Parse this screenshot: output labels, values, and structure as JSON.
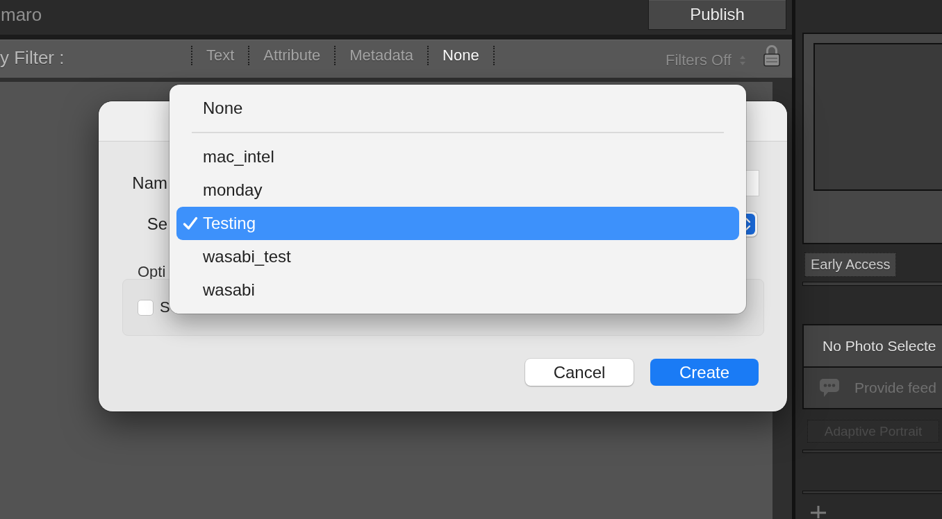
{
  "app_bar": {
    "title": "maro",
    "publish_button": "Publish"
  },
  "filter_bar": {
    "label": "y Filter :",
    "tabs": [
      {
        "label": "Text",
        "selected": false
      },
      {
        "label": "Attribute",
        "selected": false
      },
      {
        "label": "Metadata",
        "selected": false
      },
      {
        "label": "None",
        "selected": true
      }
    ],
    "filters_dropdown": "Filters Off"
  },
  "right_panel": {
    "badge": "Early Access",
    "photo_status": "No Photo Selecte",
    "feedback_button": "Provide feed",
    "preset_button": "Adaptive Portrait"
  },
  "dialog": {
    "fields": [
      {
        "label": "Nam",
        "kind": "text"
      },
      {
        "label": "Se",
        "kind": "popup"
      }
    ],
    "options_label": "Opti",
    "options": [
      {
        "label": "S",
        "checked": false
      }
    ],
    "buttons": [
      {
        "label": "Cancel",
        "kind": "secondary"
      },
      {
        "label": "Create",
        "kind": "primary"
      }
    ]
  },
  "popup_menu": {
    "sections": [
      {
        "items": [
          {
            "label": "None",
            "selected": false
          }
        ]
      },
      {
        "items": [
          {
            "label": "mac_intel",
            "selected": false
          },
          {
            "label": "monday",
            "selected": false
          },
          {
            "label": "Testing",
            "selected": true
          },
          {
            "label": "wasabi_test",
            "selected": false
          },
          {
            "label": "wasabi",
            "selected": false
          }
        ]
      }
    ]
  }
}
